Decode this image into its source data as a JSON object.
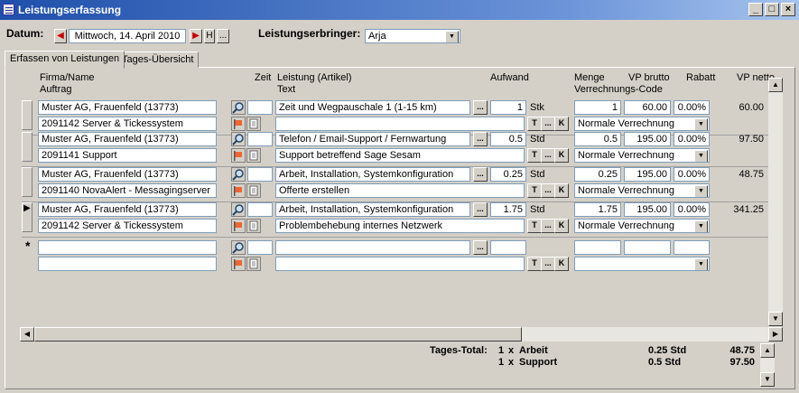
{
  "window": {
    "title": "Leistungserfassung",
    "min": "_",
    "max": "□",
    "close": "×"
  },
  "header": {
    "datum_label": "Datum:",
    "datum_value": "Mittwoch, 14. April 2010",
    "btn_h": "H",
    "btn_dots": "...",
    "erbringer_label": "Leistungserbringer:",
    "erbringer_value": "Arja"
  },
  "tabs": [
    {
      "label": "Erfassen von Leistungen"
    },
    {
      "label": "Tages-Übersicht"
    }
  ],
  "columns": {
    "firma": "Firma/Name",
    "auftrag": "Auftrag",
    "zeit": "Zeit",
    "leistung": "Leistung (Artikel)",
    "text": "Text",
    "aufwand": "Aufwand",
    "menge": "Menge",
    "vp_brutto": "VP brutto",
    "verrechnungs": "Verrechnungs-Code",
    "rabatt": "Rabatt",
    "vp_netto": "VP netto"
  },
  "rows": [
    {
      "firma": "Muster AG, Frauenfeld (13773)",
      "auftrag": "2091142 Server & Tickessystem",
      "leistung": "Zeit und Wegpauschale 1 (1-15 km)",
      "text": "",
      "aufwand": "1",
      "unit": "Stk",
      "menge": "1",
      "vp_brutto": "60.00",
      "rabatt": "0.00%",
      "vp_netto": "60.00",
      "code": "Normale Verrechnung"
    },
    {
      "firma": "Muster AG, Frauenfeld (13773)",
      "auftrag": "2091141 Support",
      "leistung": "Telefon / Email-Support / Fernwartung",
      "text": "Support betreffend Sage Sesam",
      "aufwand": "0.5",
      "unit": "Std",
      "menge": "0.5",
      "vp_brutto": "195.00",
      "rabatt": "0.00%",
      "vp_netto": "97.50",
      "code": "Normale Verrechnung"
    },
    {
      "firma": "Muster AG, Frauenfeld (13773)",
      "auftrag": "2091140 NovaAlert - Messagingserver",
      "leistung": "Arbeit, Installation, Systemkonfiguration",
      "text": "Offerte erstellen",
      "aufwand": "0.25",
      "unit": "Std",
      "menge": "0.25",
      "vp_brutto": "195.00",
      "rabatt": "0.00%",
      "vp_netto": "48.75",
      "code": "Normale Verrechnung"
    },
    {
      "firma": "Muster AG, Frauenfeld (13773)",
      "auftrag": "2091142 Server & Tickessystem",
      "leistung": "Arbeit, Installation, Systemkonfiguration",
      "text": "Problembehebung internes Netzwerk",
      "aufwand": "1.75",
      "unit": "Std",
      "menge": "1.75",
      "vp_brutto": "195.00",
      "rabatt": "0.00%",
      "vp_netto": "341.25",
      "code": "Normale Verrechnung"
    }
  ],
  "row_buttons": {
    "t": "T",
    "dots": "...",
    "k": "K"
  },
  "selectors": {
    "current": "▶",
    "new": "*"
  },
  "totals": {
    "label": "Tages-Total:",
    "lines": [
      {
        "count": "1",
        "x": "x",
        "name": "Arbeit",
        "std": "0.25 Std",
        "amount": "48.75"
      },
      {
        "count": "1",
        "x": "x",
        "name": "Support",
        "std": "0.5 Std",
        "amount": "97.50"
      }
    ]
  },
  "icons": {
    "search": "search-icon",
    "flag": "flag-icon",
    "note": "note-icon"
  }
}
